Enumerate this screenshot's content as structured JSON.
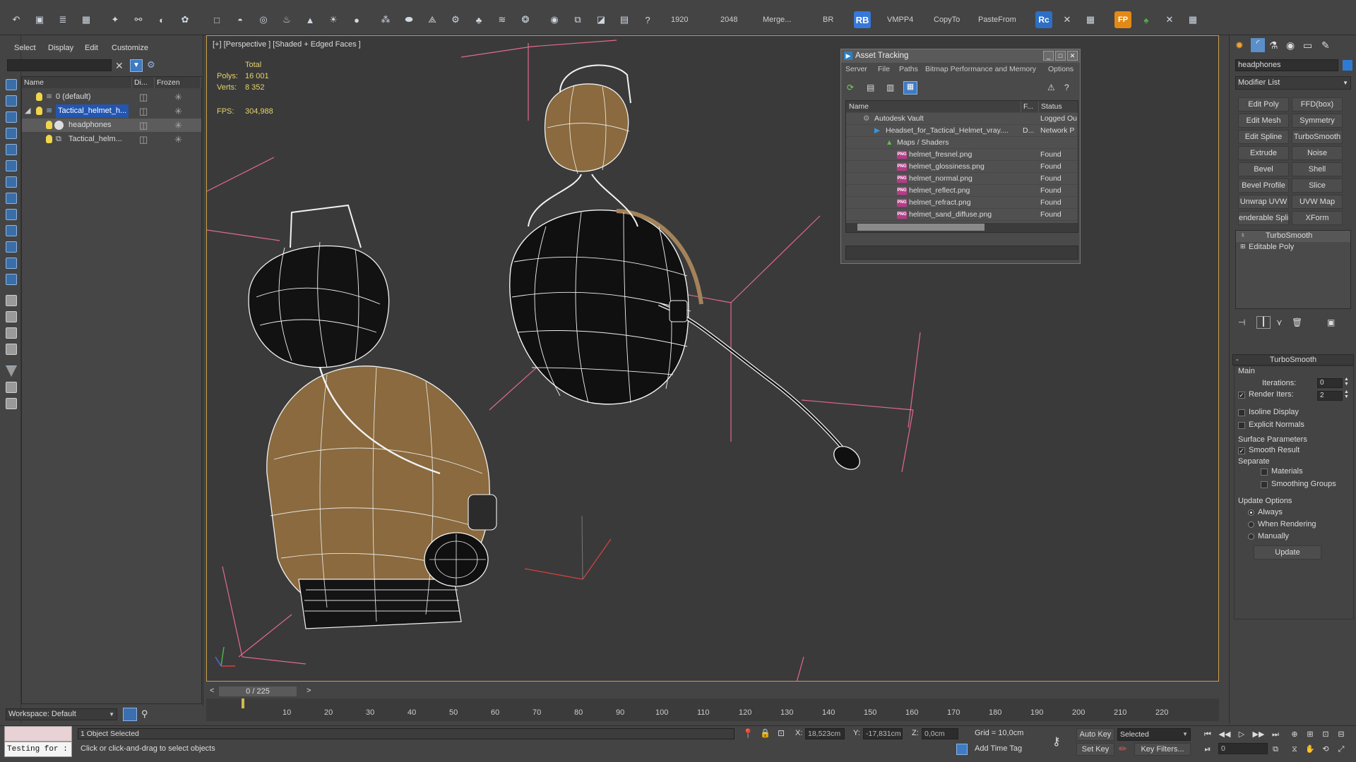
{
  "toolbar": {
    "resolution_w": "1920",
    "resolution_h": "2048",
    "merge_label": "Merge...",
    "br_label": "BR",
    "rb_label": "RB",
    "vmpp_label": "VMPP4",
    "copyto_label": "CopyTo",
    "pastefrom_label": "PasteFrom",
    "rc_label": "Rc",
    "fp_label": "FP"
  },
  "explorer": {
    "menu": [
      "Select",
      "Display",
      "Edit",
      "Customize"
    ],
    "columns": [
      "Name",
      "Di...",
      "Frozen"
    ],
    "rows": [
      {
        "label": "0 (default)"
      },
      {
        "label": "Tactical_helmet_h..."
      },
      {
        "label": "headphones"
      },
      {
        "label": "Tactical_helm..."
      }
    ],
    "workspace": "Workspace: Default"
  },
  "viewport": {
    "label": "[+] [Perspective ] [Shaded + Edged Faces ]",
    "total_label": "Total",
    "polys_label": "Polys:",
    "polys_value": "16 001",
    "verts_label": "Verts:",
    "verts_value": "8 352",
    "fps_label": "FPS:",
    "fps_value": "304,988"
  },
  "asset_tracking": {
    "title": "Asset Tracking",
    "menu": [
      "Server",
      "File",
      "Paths",
      "Bitmap Performance and Memory",
      "Options"
    ],
    "columns": [
      "Name",
      "F...",
      "Status"
    ],
    "rows": [
      {
        "name": "Autodesk Vault",
        "f": "",
        "status": "Logged Ou"
      },
      {
        "name": "Headset_for_Tactical_Helmet_vray....",
        "f": "D...",
        "status": "Network P"
      },
      {
        "name": "Maps / Shaders",
        "f": "",
        "status": ""
      },
      {
        "name": "helmet_fresnel.png",
        "f": "",
        "status": "Found"
      },
      {
        "name": "helmet_glossiness.png",
        "f": "",
        "status": "Found"
      },
      {
        "name": "helmet_normal.png",
        "f": "",
        "status": "Found"
      },
      {
        "name": "helmet_reflect.png",
        "f": "",
        "status": "Found"
      },
      {
        "name": "helmet_refract.png",
        "f": "",
        "status": "Found"
      },
      {
        "name": "helmet_sand_diffuse.png",
        "f": "",
        "status": "Found"
      }
    ]
  },
  "command_panel": {
    "object_name": "headphones",
    "modifier_list": "Modifier List",
    "modifier_buttons": [
      "Edit Poly",
      "FFD(box)",
      "Edit Mesh",
      "Symmetry",
      "Edit Spline",
      "TurboSmooth",
      "Extrude",
      "Noise",
      "Bevel",
      "Shell",
      "Bevel Profile",
      "Slice",
      "Unwrap UVW",
      "UVW Map",
      "enderable Splir",
      "XForm"
    ],
    "stack": [
      "TurboSmooth",
      "Editable Poly"
    ],
    "rollout_title": "TurboSmooth",
    "main_label": "Main",
    "iterations_label": "Iterations:",
    "iterations_value": "0",
    "render_iters_label": "Render Iters:",
    "render_iters_value": "2",
    "isoline_label": "Isoline Display",
    "explicit_normals_label": "Explicit Normals",
    "surface_params_label": "Surface Parameters",
    "smooth_result_label": "Smooth Result",
    "separate_label": "Separate",
    "materials_label": "Materials",
    "smoothing_groups_label": "Smoothing Groups",
    "update_options_label": "Update Options",
    "always_label": "Always",
    "when_rendering_label": "When Rendering",
    "manually_label": "Manually",
    "update_button": "Update"
  },
  "timeline": {
    "frame": "0 / 225",
    "ticks": [
      "10",
      "20",
      "30",
      "40",
      "50",
      "60",
      "70",
      "80",
      "90",
      "100",
      "110",
      "120",
      "130",
      "140",
      "150",
      "160",
      "170",
      "180",
      "190",
      "200",
      "210",
      "220"
    ]
  },
  "status": {
    "maxscript": "Testing for :",
    "selected": "1 Object Selected",
    "prompt": "Click or click-and-drag to select objects",
    "x_label": "X:",
    "x_value": "18,523cm",
    "y_label": "Y:",
    "y_value": "-17,831cm",
    "z_label": "Z:",
    "z_value": "0,0cm",
    "grid": "Grid = 10,0cm",
    "add_time_tag": "Add Time Tag",
    "auto_key": "Auto Key",
    "set_key": "Set Key",
    "selected_dropdown": "Selected",
    "key_filters": "Key Filters...",
    "frame_field": "0"
  }
}
